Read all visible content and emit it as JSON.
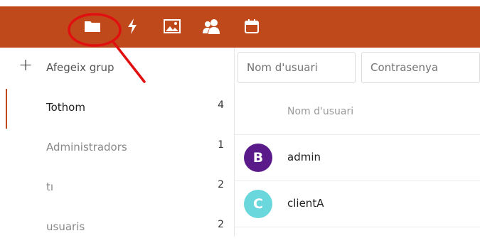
{
  "colors": {
    "brand": "#c0491b",
    "annotation": "#e01010",
    "avatar_admin": "#5b1a8a",
    "avatar_client": "#6ad7dd"
  },
  "topbar": {
    "icons": [
      "folder-icon",
      "activity-icon",
      "image-icon",
      "users-icon",
      "calendar-icon"
    ]
  },
  "sidebar": {
    "add_group": "Afegeix grup",
    "items": [
      {
        "label": "Tothom",
        "count": "4"
      },
      {
        "label": "Administradors",
        "count": "1"
      },
      {
        "label": "tı",
        "count": "2"
      },
      {
        "label": "usuaris",
        "count": "2"
      }
    ]
  },
  "main": {
    "username_placeholder": "Nom d'usuari",
    "password_placeholder": "Contrasenya",
    "column_header": "Nom d'usuari",
    "users": [
      {
        "initial": "B",
        "name": "admin"
      },
      {
        "initial": "C",
        "name": "clientA"
      }
    ]
  }
}
